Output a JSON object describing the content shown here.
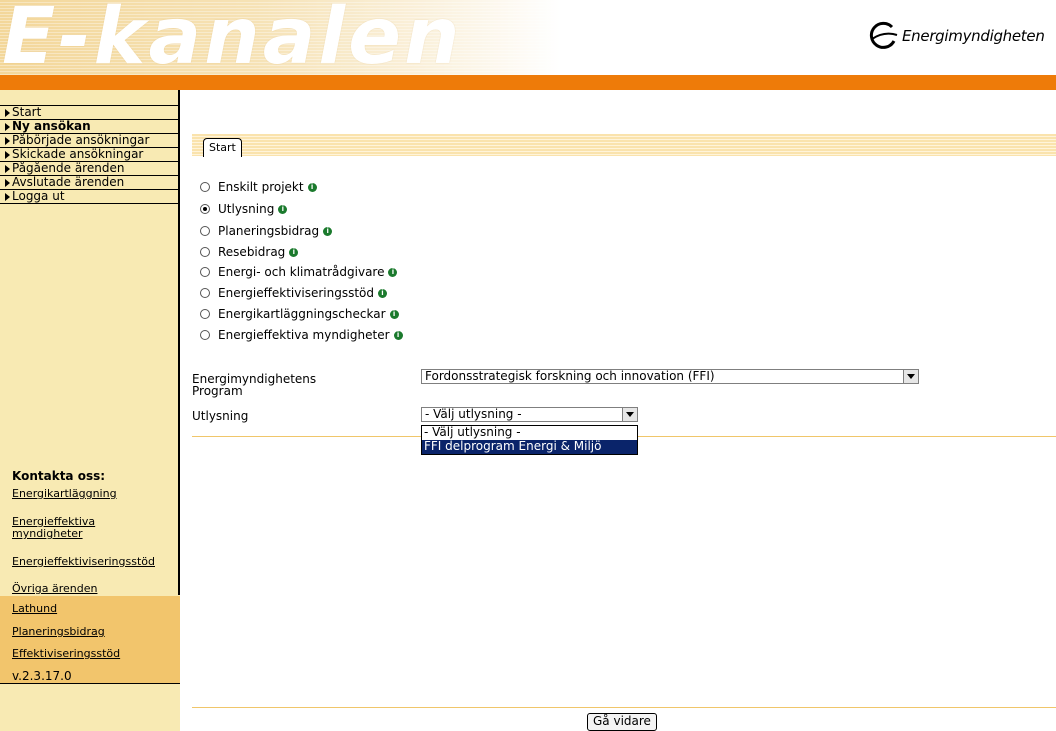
{
  "header": {
    "banner_title": "E-kanalen",
    "logo_text": "Energimyndigheten"
  },
  "sidebar": {
    "nav": [
      {
        "label": "Start",
        "bold": false
      },
      {
        "label": "Ny ansökan",
        "bold": true
      },
      {
        "label": "Påbörjade ansökningar",
        "bold": false
      },
      {
        "label": "Skickade ansökningar",
        "bold": false
      },
      {
        "label": "Pågående ärenden",
        "bold": false
      },
      {
        "label": "Avslutade ärenden",
        "bold": false
      },
      {
        "label": "Logga ut",
        "bold": false
      }
    ],
    "contact_title": "Kontakta oss:",
    "contact_links": [
      "Energikartläggning",
      "Energieffektiva myndigheter",
      "Energieffektiviseringsstöd",
      "Övriga ärenden"
    ],
    "extra_links": [
      "Lathund",
      "Planeringsbidrag",
      "Effektiviseringsstöd"
    ],
    "version": "v.2.3.17.0"
  },
  "main": {
    "tab_label": "Start",
    "radio_options": [
      {
        "label": "Enskilt projekt",
        "checked": false
      },
      {
        "label": "Utlysning",
        "checked": true
      },
      {
        "label": "Planeringsbidrag",
        "checked": false
      },
      {
        "label": "Resebidrag",
        "checked": false
      },
      {
        "label": "Energi- och klimatrådgivare",
        "checked": false
      },
      {
        "label": "Energieffektiviseringsstöd",
        "checked": false
      },
      {
        "label": "Energikartläggningscheckar",
        "checked": false
      },
      {
        "label": "Energieffektiva myndigheter",
        "checked": false
      }
    ],
    "program_label_line1": "Energimyndighetens",
    "program_label_line2": "Program",
    "program_value": "Fordonsstrategisk forskning och innovation (FFI)",
    "utlysning_label": "Utlysning",
    "utlysning_value": "- Välj utlysning -",
    "utlysning_options": [
      "- Välj utlysning -",
      "FFI delprogram Energi & Miljö"
    ],
    "utlysning_highlighted": 1,
    "submit_label": "Gå vidare"
  },
  "colors": {
    "orange_bar": "#ee7b09",
    "sidebar_bg": "#f8eab3",
    "sidebar_lower_bg": "#f2c56c",
    "info_icon": "#1b7a2d",
    "dropdown_highlight": "#0a246a"
  },
  "icons": {
    "nav_arrow": "triangle-right-icon",
    "info": "info-icon",
    "logo": "energimyndigheten-logo-icon"
  }
}
